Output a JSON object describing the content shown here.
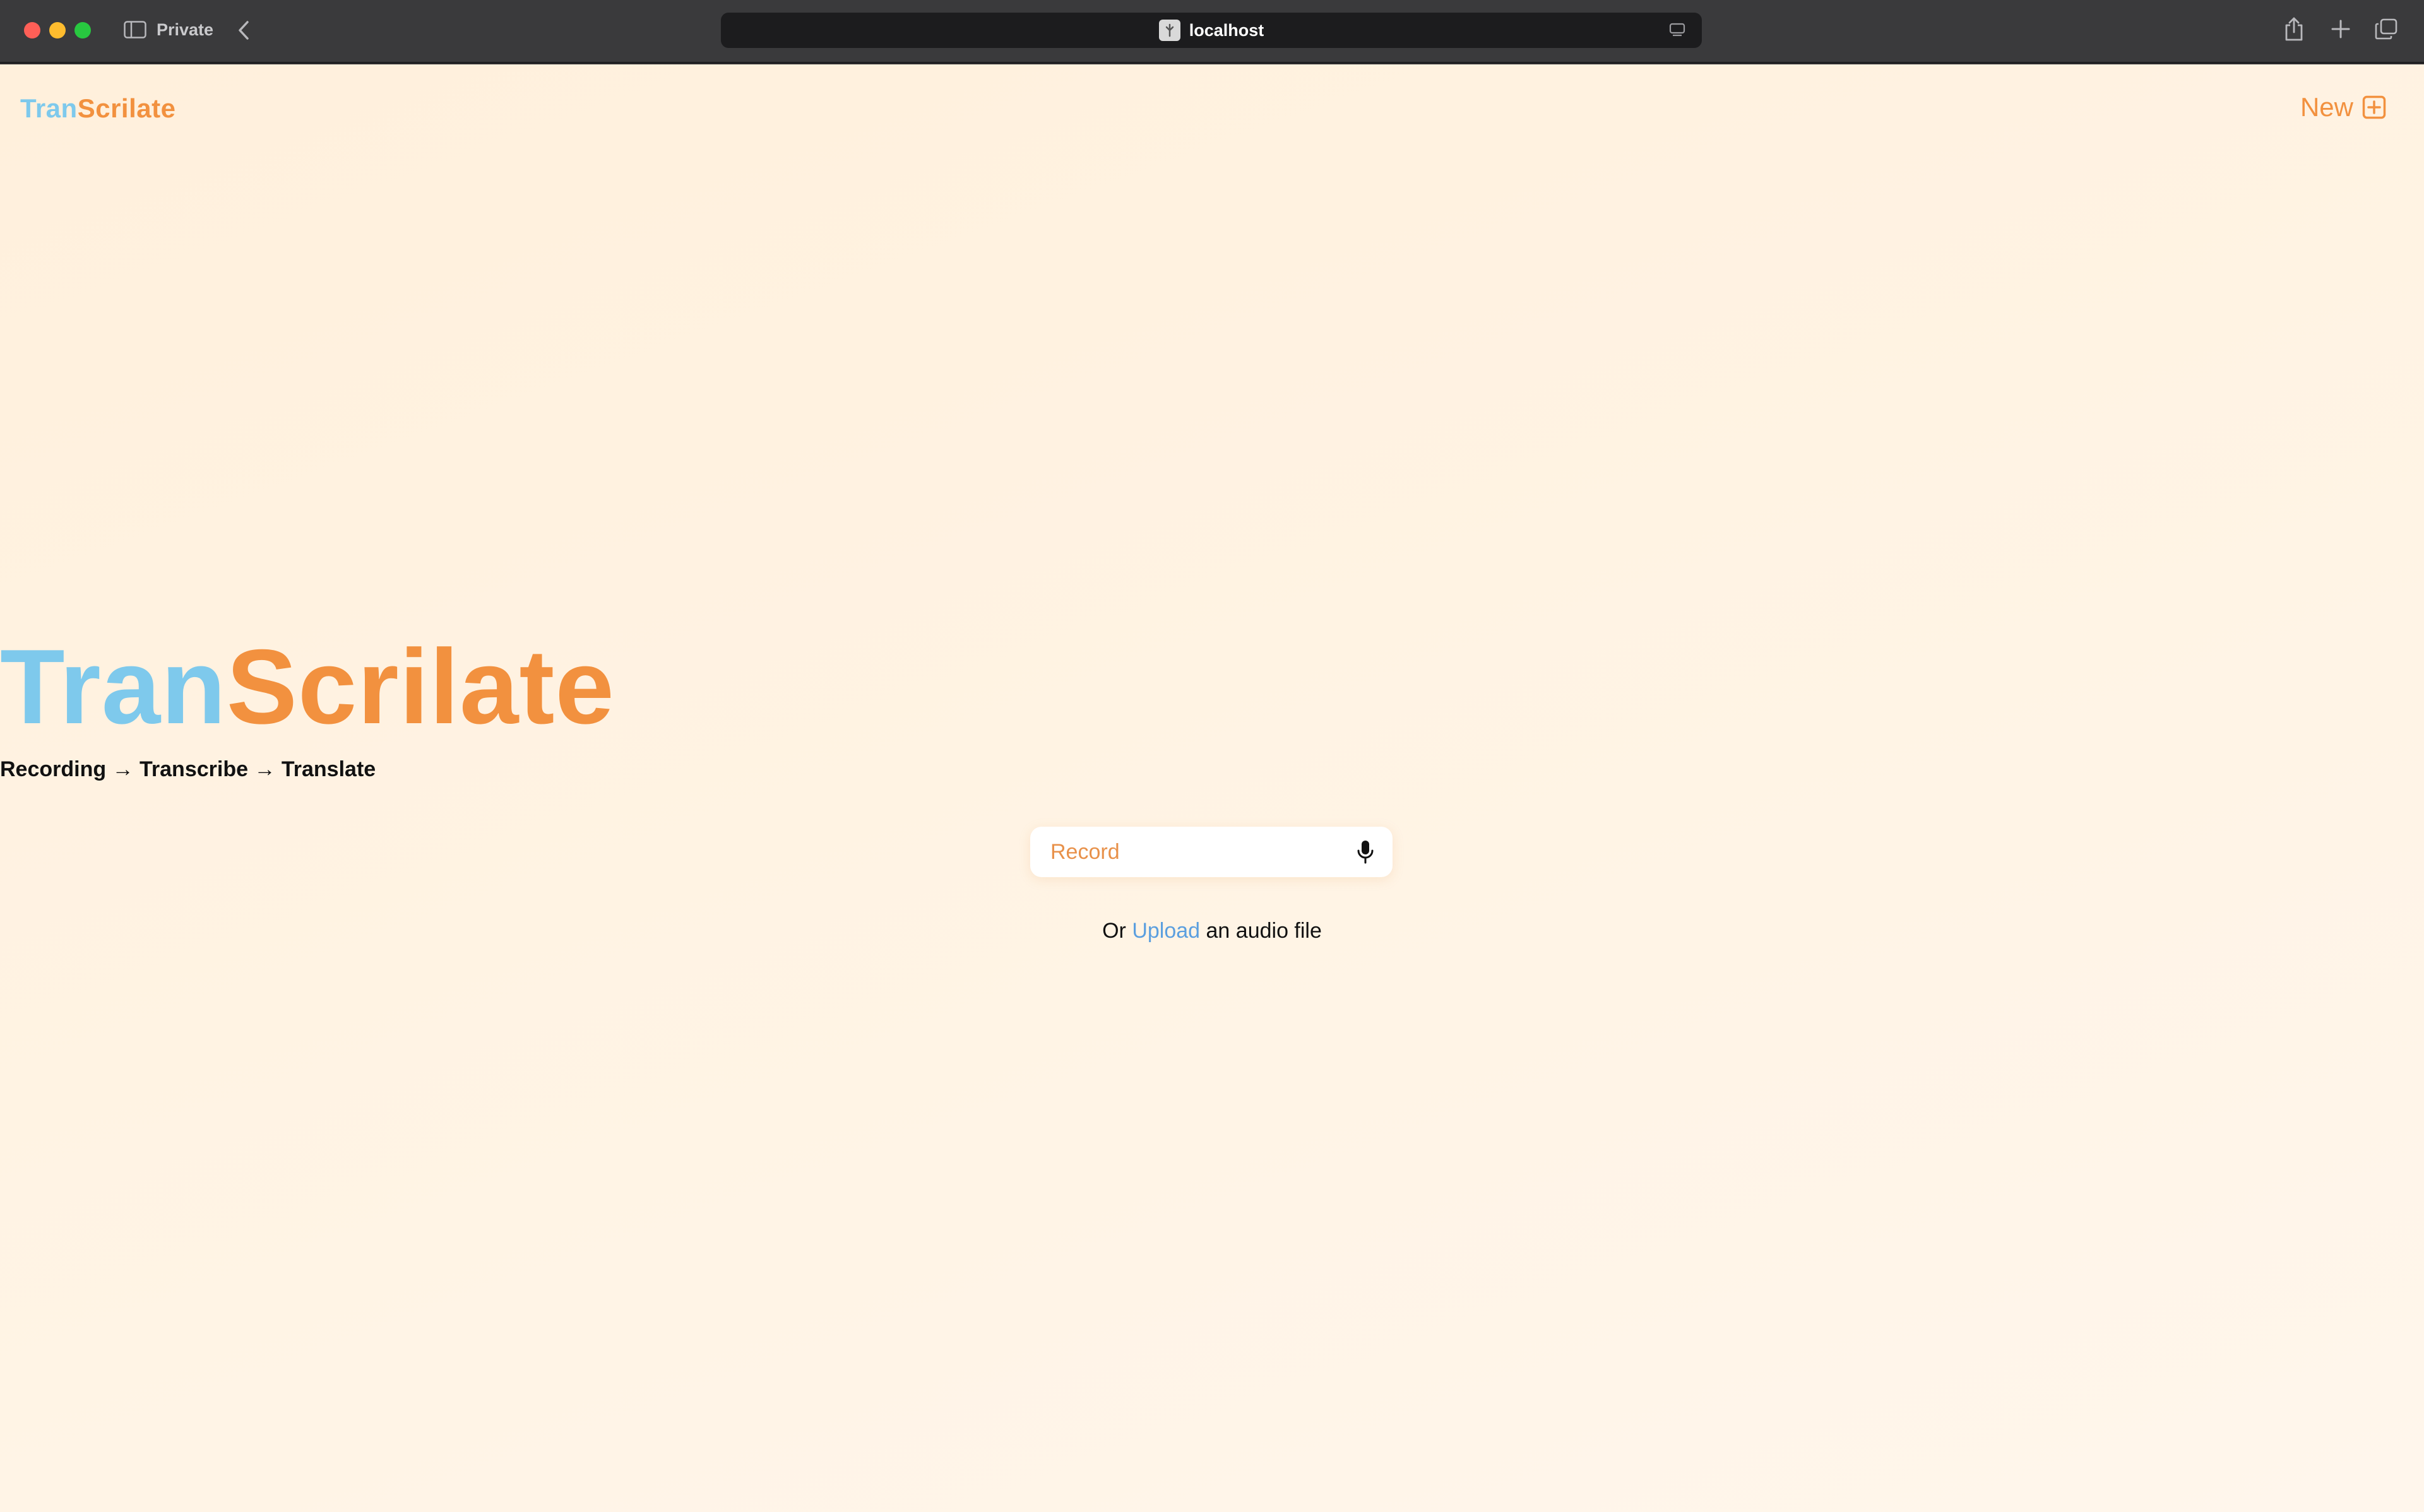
{
  "browser": {
    "mode_label": "Private",
    "address": "localhost"
  },
  "header": {
    "logo_part1": "Tran",
    "logo_part2": "Scrilate",
    "new_label": "New"
  },
  "hero": {
    "title_part1": "Tran",
    "title_part2": "Scrilate",
    "subtitle": "Recording → Transcribe → Translate"
  },
  "record": {
    "label": "Record"
  },
  "upload": {
    "prefix": "Or ",
    "link": "Upload",
    "suffix": " an audio file"
  },
  "colors": {
    "brand_blue": "#7ec9ec",
    "brand_orange": "#f2913f",
    "link_blue": "#5b9fdf"
  },
  "icons": {
    "sidebar": "sidebar-icon",
    "back": "chevron-left-icon",
    "reader": "reader-icon",
    "share": "share-icon",
    "new_tab": "plus-icon",
    "tabs": "tabs-overview-icon",
    "new": "plus-square-icon",
    "record": "microphone-icon"
  }
}
